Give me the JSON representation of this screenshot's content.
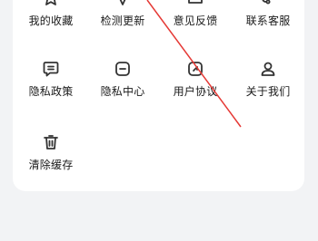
{
  "grid": {
    "items": [
      {
        "label": "我的收藏",
        "icon": "star-icon"
      },
      {
        "label": "检测更新",
        "icon": "refresh-icon"
      },
      {
        "label": "意见反馈",
        "icon": "feedback-icon"
      },
      {
        "label": "联系客服",
        "icon": "headset-icon"
      },
      {
        "label": "隐私政策",
        "icon": "privacy-policy-icon"
      },
      {
        "label": "隐私中心",
        "icon": "privacy-center-icon"
      },
      {
        "label": "用户协议",
        "icon": "user-agreement-icon"
      },
      {
        "label": "关于我们",
        "icon": "about-user-icon"
      },
      {
        "label": "清除缓存",
        "icon": "trash-icon"
      }
    ]
  },
  "colors": {
    "background": "#f2f3f5",
    "card": "#ffffff",
    "icon": "#333333",
    "annotation_arrow": "#e53935"
  }
}
